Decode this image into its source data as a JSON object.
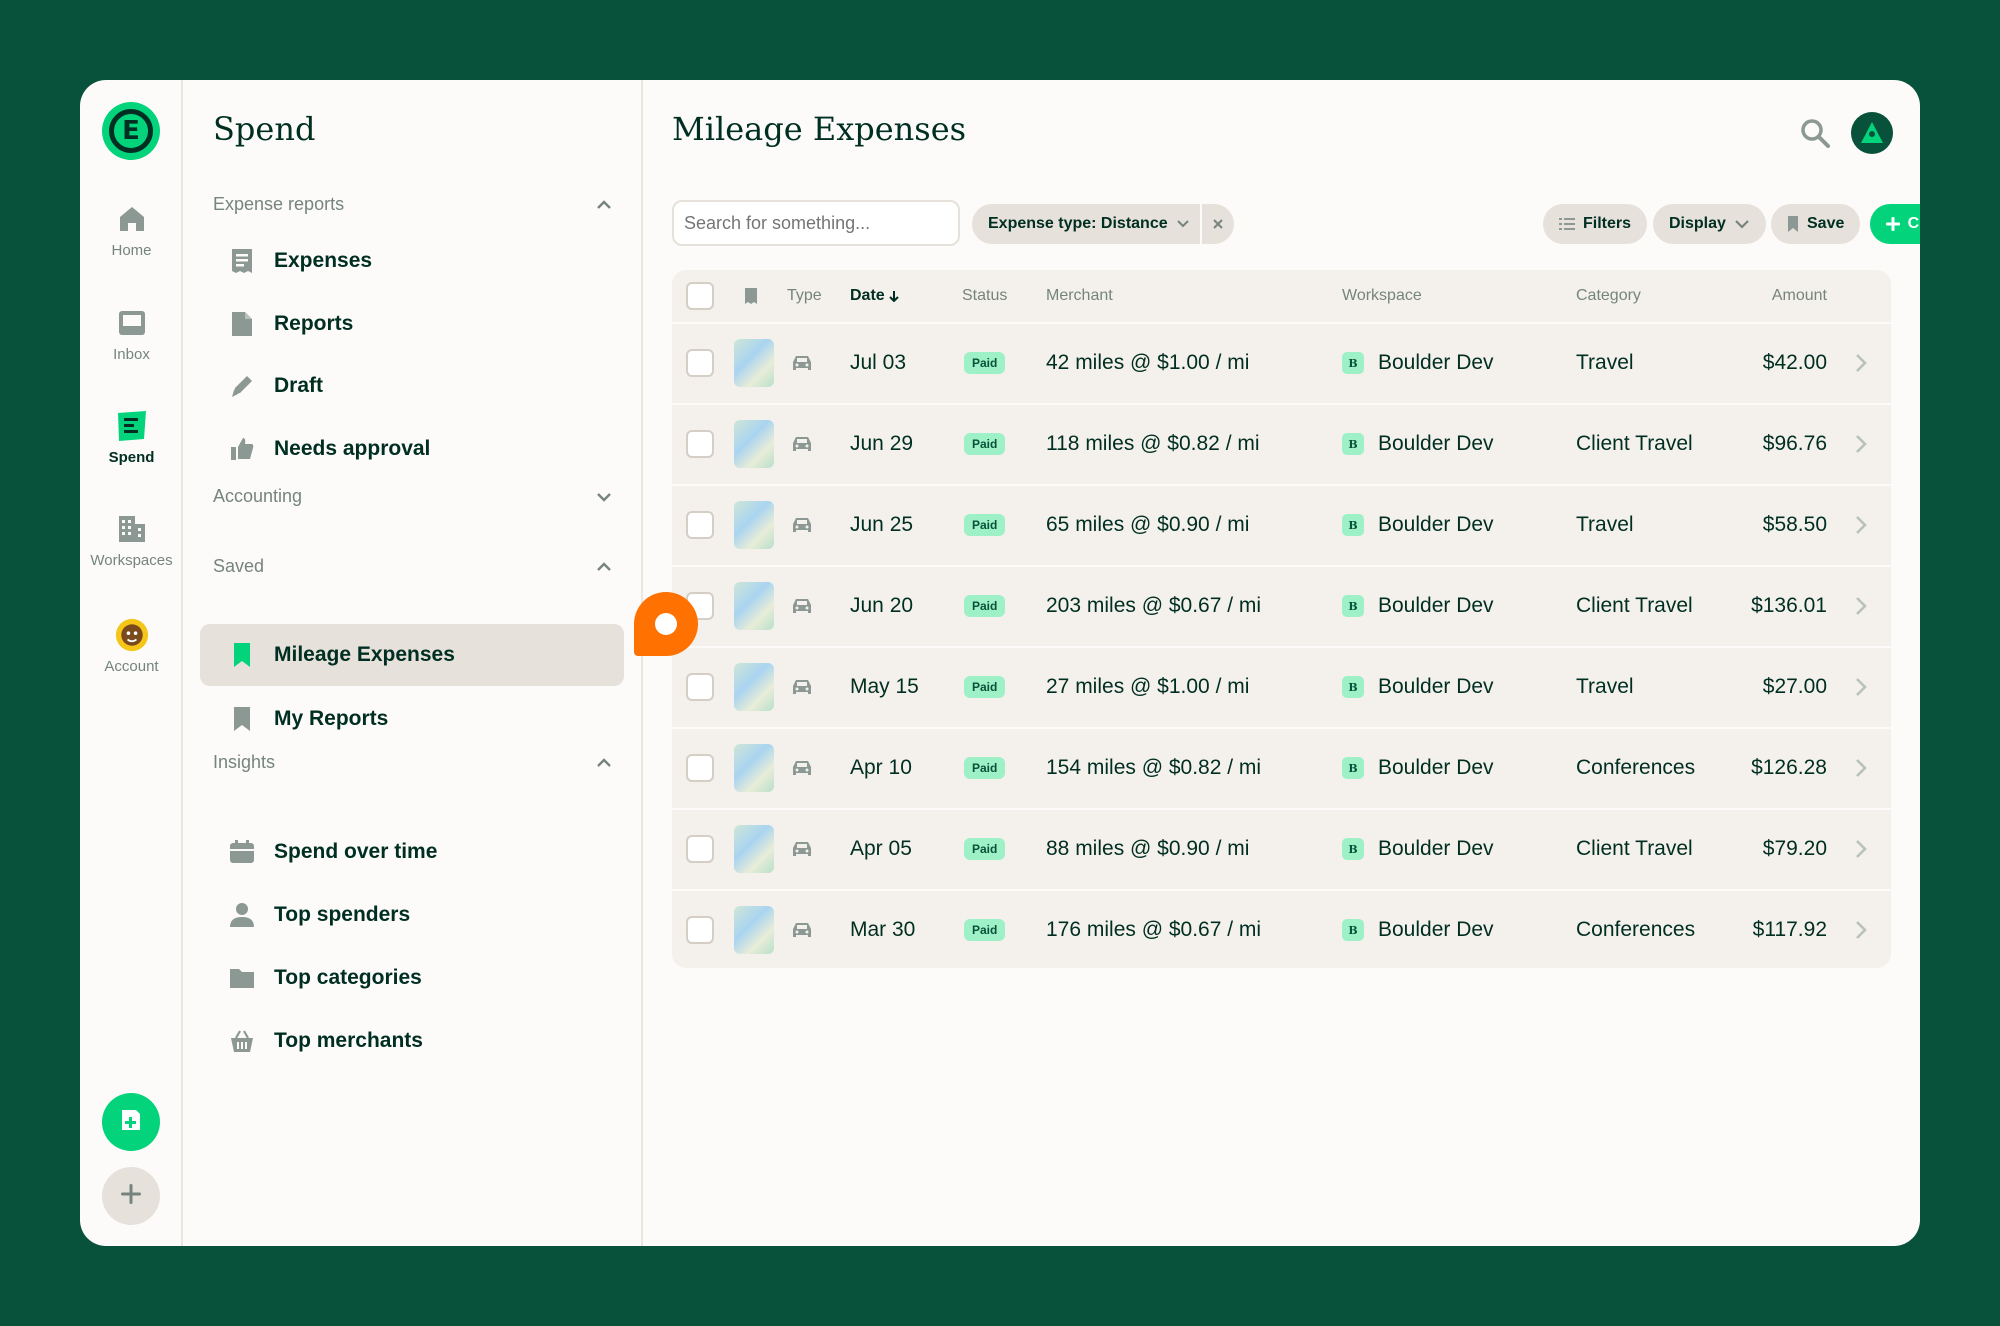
{
  "rail": {
    "items": [
      {
        "label": "Home",
        "icon": "home-icon"
      },
      {
        "label": "Inbox",
        "icon": "inbox-icon"
      },
      {
        "label": "Spend",
        "icon": "receipt-icon"
      },
      {
        "label": "Workspaces",
        "icon": "building-icon"
      },
      {
        "label": "Account",
        "icon": "avatar-icon"
      }
    ],
    "fab_icon": "new-expense-icon",
    "add_icon": "plus-icon"
  },
  "sidebar": {
    "title": "Spend",
    "sections": {
      "expense_reports": {
        "label": "Expense reports",
        "expanded": true
      },
      "accounting": {
        "label": "Accounting",
        "expanded": false
      },
      "saved": {
        "label": "Saved",
        "expanded": true
      },
      "insights": {
        "label": "Insights",
        "expanded": true
      }
    },
    "items": {
      "expenses": "Expenses",
      "reports": "Reports",
      "draft": "Draft",
      "needs_approval": "Needs approval",
      "mileage_expenses": "Mileage Expenses",
      "my_reports": "My Reports",
      "spend_over_time": "Spend over time",
      "top_spenders": "Top spenders",
      "top_categories": "Top categories",
      "top_merchants": "Top merchants"
    }
  },
  "main": {
    "title": "Mileage Expenses",
    "search_placeholder": "Search for something...",
    "filter_chip": "Expense type: Distance",
    "buttons": {
      "filters": "Filters",
      "display": "Display",
      "save": "Save",
      "create": "Create"
    },
    "columns": {
      "type": "Type",
      "date": "Date",
      "status": "Status",
      "merchant": "Merchant",
      "workspace": "Workspace",
      "category": "Category",
      "amount": "Amount"
    },
    "rows": [
      {
        "date": "Jul 03",
        "status": "Paid",
        "merchant": "42 miles @ $1.00 / mi",
        "ws_initial": "B",
        "workspace": "Boulder Dev",
        "category": "Travel",
        "amount": "$42.00"
      },
      {
        "date": "Jun 29",
        "status": "Paid",
        "merchant": "118 miles @ $0.82 / mi",
        "ws_initial": "B",
        "workspace": "Boulder Dev",
        "category": "Client Travel",
        "amount": "$96.76"
      },
      {
        "date": "Jun 25",
        "status": "Paid",
        "merchant": "65 miles @ $0.90 / mi",
        "ws_initial": "B",
        "workspace": "Boulder Dev",
        "category": "Travel",
        "amount": "$58.50"
      },
      {
        "date": "Jun 20",
        "status": "Paid",
        "merchant": "203 miles @ $0.67 / mi",
        "ws_initial": "B",
        "workspace": "Boulder Dev",
        "category": "Client Travel",
        "amount": "$136.01"
      },
      {
        "date": "May 15",
        "status": "Paid",
        "merchant": "27 miles @ $1.00 / mi",
        "ws_initial": "B",
        "workspace": "Boulder Dev",
        "category": "Travel",
        "amount": "$27.00"
      },
      {
        "date": "Apr 10",
        "status": "Paid",
        "merchant": "154 miles @ $0.82 / mi",
        "ws_initial": "B",
        "workspace": "Boulder Dev",
        "category": "Conferences",
        "amount": "$126.28"
      },
      {
        "date": "Apr 05",
        "status": "Paid",
        "merchant": "88 miles @ $0.90 / mi",
        "ws_initial": "B",
        "workspace": "Boulder Dev",
        "category": "Client Travel",
        "amount": "$79.20"
      },
      {
        "date": "Mar 30",
        "status": "Paid",
        "merchant": "176 miles @ $0.67 / mi",
        "ws_initial": "B",
        "workspace": "Boulder Dev",
        "category": "Conferences",
        "amount": "$117.92"
      }
    ]
  },
  "colors": {
    "background": "#08513a",
    "accent": "#03d47c",
    "badge": "#9ef0c6",
    "marker": "#ff7101"
  }
}
